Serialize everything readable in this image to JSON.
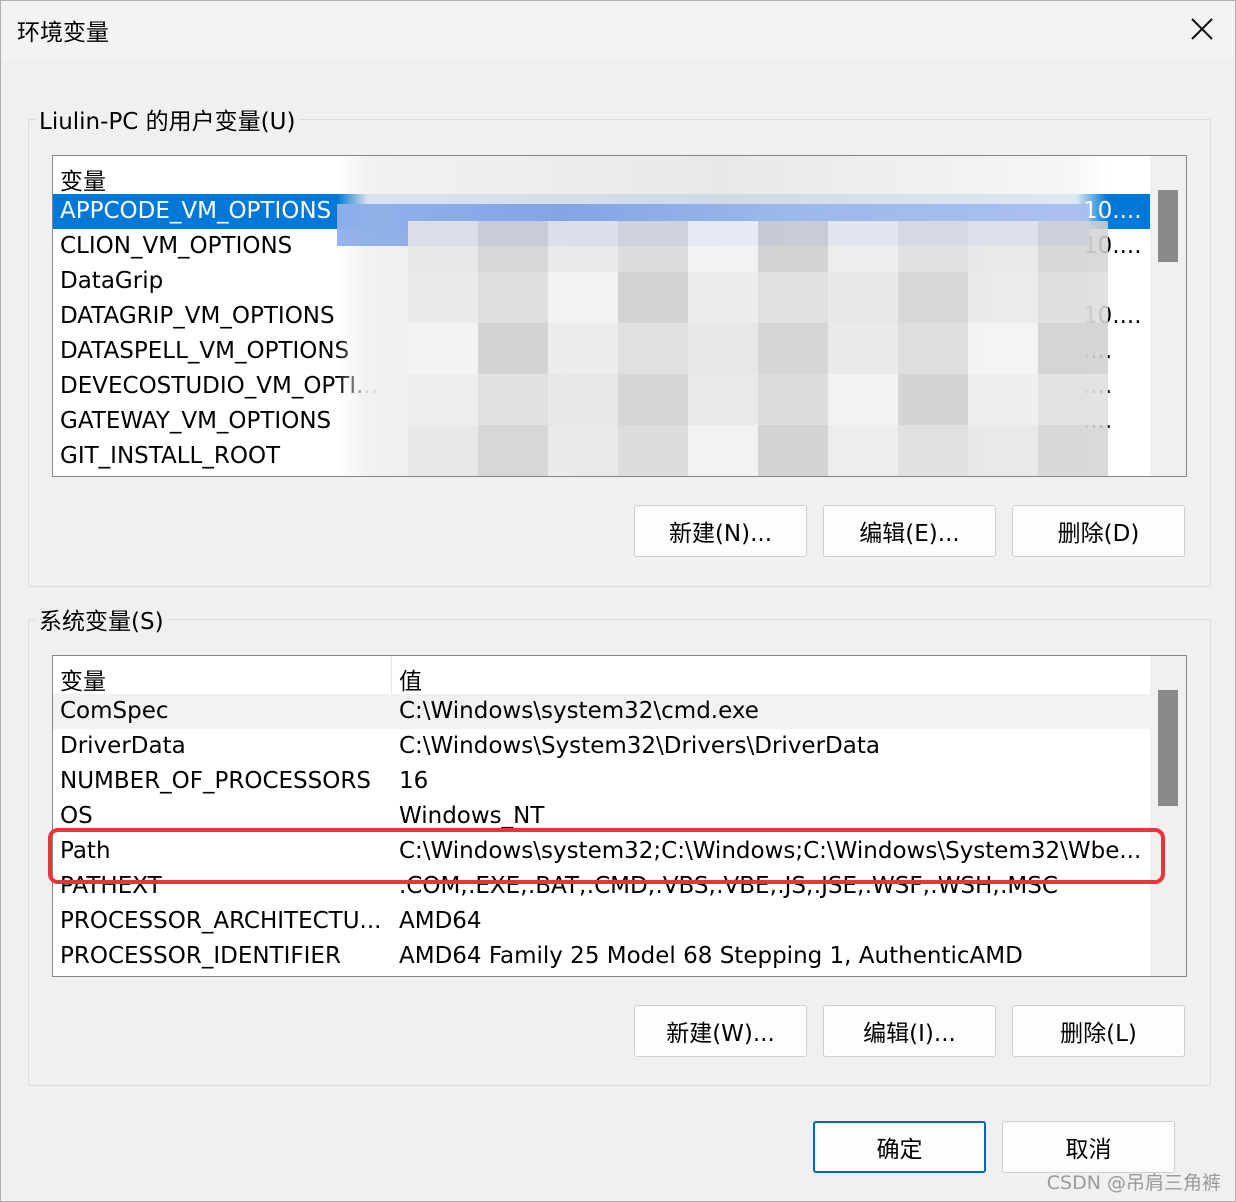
{
  "window": {
    "title": "环境变量"
  },
  "user_group": {
    "title": "Liulin-PC 的用户变量(U)",
    "header": {
      "col1": "变量",
      "col2": ""
    },
    "rows": [
      {
        "name": "APPCODE_VM_OPTIONS",
        "value": "10....",
        "state": "selected"
      },
      {
        "name": "CLION_VM_OPTIONS",
        "value": "10....",
        "state": "normal"
      },
      {
        "name": "DataGrip",
        "value": "",
        "state": "normal"
      },
      {
        "name": "DATAGRIP_VM_OPTIONS",
        "value": "10....",
        "state": "normal"
      },
      {
        "name": "DATASPELL_VM_OPTIONS",
        "value": "....",
        "state": "normal"
      },
      {
        "name": "DEVECOSTUDIO_VM_OPTI...",
        "value": "....",
        "state": "normal"
      },
      {
        "name": "GATEWAY_VM_OPTIONS",
        "value": "....",
        "state": "normal"
      },
      {
        "name": "GIT_INSTALL_ROOT",
        "value": "",
        "state": "normal"
      }
    ],
    "buttons": {
      "new": "新建(N)...",
      "edit": "编辑(E)...",
      "delete": "删除(D)"
    }
  },
  "system_group": {
    "title": "系统变量(S)",
    "header": {
      "col1": "变量",
      "col2": "值"
    },
    "rows": [
      {
        "name": "ComSpec",
        "value": "C:\\Windows\\system32\\cmd.exe",
        "state": "hover"
      },
      {
        "name": "DriverData",
        "value": "C:\\Windows\\System32\\Drivers\\DriverData",
        "state": "normal"
      },
      {
        "name": "NUMBER_OF_PROCESSORS",
        "value": "16",
        "state": "normal"
      },
      {
        "name": "OS",
        "value": "Windows_NT",
        "state": "normal"
      },
      {
        "name": "Path",
        "value": "C:\\Windows\\system32;C:\\Windows;C:\\Windows\\System32\\Wbe...",
        "state": "normal"
      },
      {
        "name": "PATHEXT",
        "value": ".COM;.EXE;.BAT;.CMD;.VBS;.VBE;.JS;.JSE;.WSF;.WSH;.MSC",
        "state": "normal"
      },
      {
        "name": "PROCESSOR_ARCHITECTU...",
        "value": "AMD64",
        "state": "normal"
      },
      {
        "name": "PROCESSOR_IDENTIFIER",
        "value": "AMD64 Family 25 Model 68 Stepping 1, AuthenticAMD",
        "state": "normal"
      }
    ],
    "buttons": {
      "new": "新建(W)...",
      "edit": "编辑(I)...",
      "delete": "删除(L)"
    }
  },
  "footer": {
    "ok": "确定",
    "cancel": "取消"
  },
  "watermark": "CSDN @吊肩三角裤",
  "colors": {
    "selection": "#0078d7",
    "highlight": "#e8353a",
    "accent_border": "#0067c0"
  },
  "icons": {
    "close": "close-icon"
  }
}
